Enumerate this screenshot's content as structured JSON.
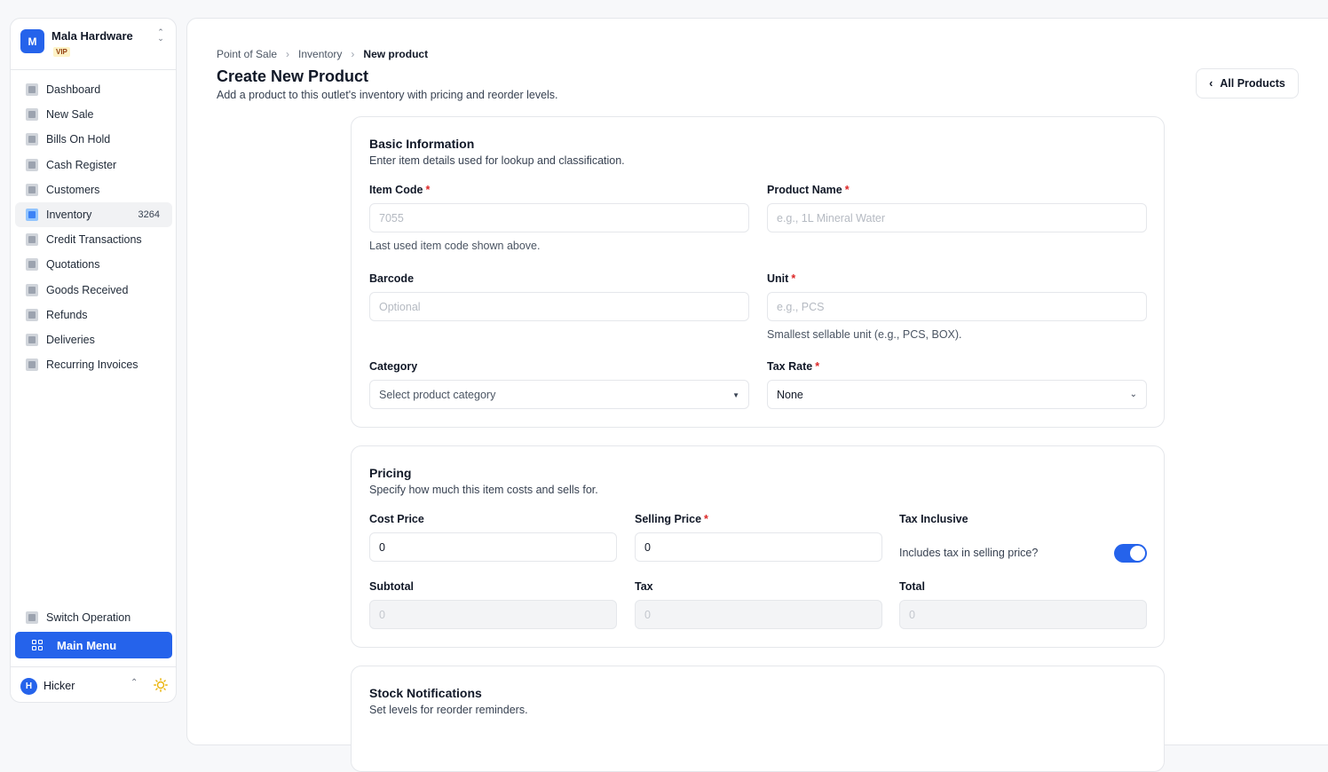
{
  "org": {
    "initial": "M",
    "name": "Mala Hardware",
    "badge": "VIP"
  },
  "nav": [
    {
      "label": "Dashboard",
      "icon": "dashboard-icon"
    },
    {
      "label": "New Sale",
      "icon": "new-sale-icon"
    },
    {
      "label": "Bills On Hold",
      "icon": "bills-hold-icon"
    },
    {
      "label": "Cash Register",
      "icon": "cash-register-icon"
    },
    {
      "label": "Customers",
      "icon": "customers-icon"
    },
    {
      "label": "Inventory",
      "icon": "inventory-icon",
      "count": "3264",
      "active": true
    },
    {
      "label": "Credit Transactions",
      "icon": "credit-icon"
    },
    {
      "label": "Quotations",
      "icon": "quotations-icon"
    },
    {
      "label": "Goods Received",
      "icon": "goods-received-icon"
    },
    {
      "label": "Refunds",
      "icon": "refunds-icon"
    },
    {
      "label": "Deliveries",
      "icon": "deliveries-icon"
    },
    {
      "label": "Recurring Invoices",
      "icon": "recurring-icon"
    }
  ],
  "footer": {
    "switch_operation": "Switch Operation",
    "main_menu": "Main Menu",
    "user_initial": "H",
    "user_name": "Hicker"
  },
  "breadcrumb": [
    "Point of Sale",
    "Inventory",
    "New product"
  ],
  "page": {
    "title": "Create New Product",
    "subtitle": "Add a product to this outlet's inventory with pricing and reorder levels.",
    "all_products": "All Products"
  },
  "basic": {
    "title": "Basic Information",
    "subtitle": "Enter item details used for lookup and classification.",
    "item_code_label": "Item Code",
    "item_code_placeholder": "7055",
    "item_code_help": "Last used item code shown above.",
    "product_name_label": "Product Name",
    "product_name_placeholder": "e.g., 1L Mineral Water",
    "barcode_label": "Barcode",
    "barcode_placeholder": "Optional",
    "unit_label": "Unit",
    "unit_placeholder": "e.g., PCS",
    "unit_help": "Smallest sellable unit (e.g., PCS, BOX).",
    "category_label": "Category",
    "category_value": "Select product category",
    "tax_rate_label": "Tax Rate",
    "tax_rate_value": "None"
  },
  "pricing": {
    "title": "Pricing",
    "subtitle": "Specify how much this item costs and sells for.",
    "cost_label": "Cost Price",
    "cost_value": "0",
    "selling_label": "Selling Price",
    "selling_value": "0",
    "tax_inclusive_label": "Tax Inclusive",
    "tax_inclusive_text": "Includes tax in selling price?",
    "tax_inclusive_on": true,
    "subtotal_label": "Subtotal",
    "subtotal_value": "0",
    "tax_label": "Tax",
    "tax_value": "0",
    "total_label": "Total",
    "total_value": "0"
  },
  "stock": {
    "title": "Stock Notifications",
    "subtitle": "Set levels for reorder reminders."
  },
  "colors": {
    "accent": "#2563eb",
    "required": "#dc2626"
  }
}
